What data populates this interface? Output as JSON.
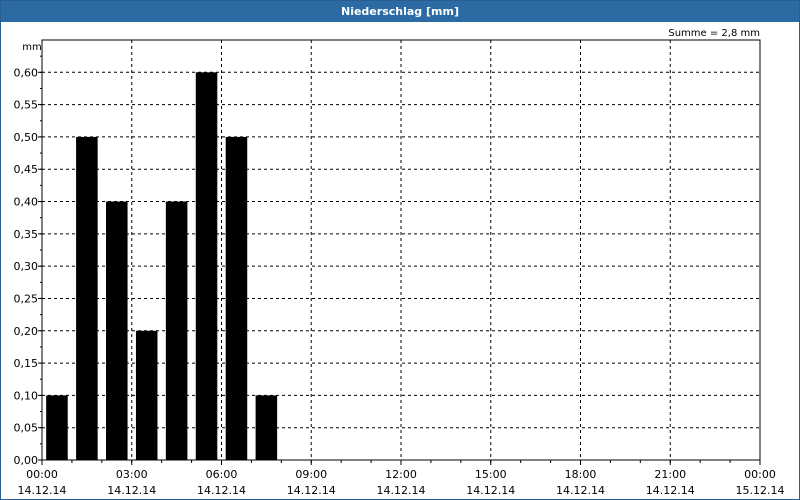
{
  "window": {
    "title": "Niederschlag [mm]"
  },
  "chart_data": {
    "type": "bar",
    "title": "Niederschlag [mm]",
    "ylabel": "mm",
    "annotation": "Summe = 2,8 mm",
    "ylim": [
      0,
      0.65
    ],
    "yticks": [
      "0,00",
      "0,05",
      "0,10",
      "0,15",
      "0,20",
      "0,25",
      "0,30",
      "0,35",
      "0,40",
      "0,45",
      "0,50",
      "0,55",
      "0,60"
    ],
    "xticks": [
      {
        "time": "00:00",
        "date": "14.12.14"
      },
      {
        "time": "03:00",
        "date": "14.12.14"
      },
      {
        "time": "06:00",
        "date": "14.12.14"
      },
      {
        "time": "09:00",
        "date": "14.12.14"
      },
      {
        "time": "12:00",
        "date": "14.12.14"
      },
      {
        "time": "15:00",
        "date": "14.12.14"
      },
      {
        "time": "18:00",
        "date": "14.12.14"
      },
      {
        "time": "21:00",
        "date": "14.12.14"
      },
      {
        "time": "00:00",
        "date": "15.12.14"
      }
    ],
    "x_interval": "hourly",
    "values": [
      0.1,
      0.5,
      0.4,
      0.2,
      0.4,
      0.6,
      0.5,
      0.1
    ],
    "bar_color": "#000000",
    "grid": true
  }
}
